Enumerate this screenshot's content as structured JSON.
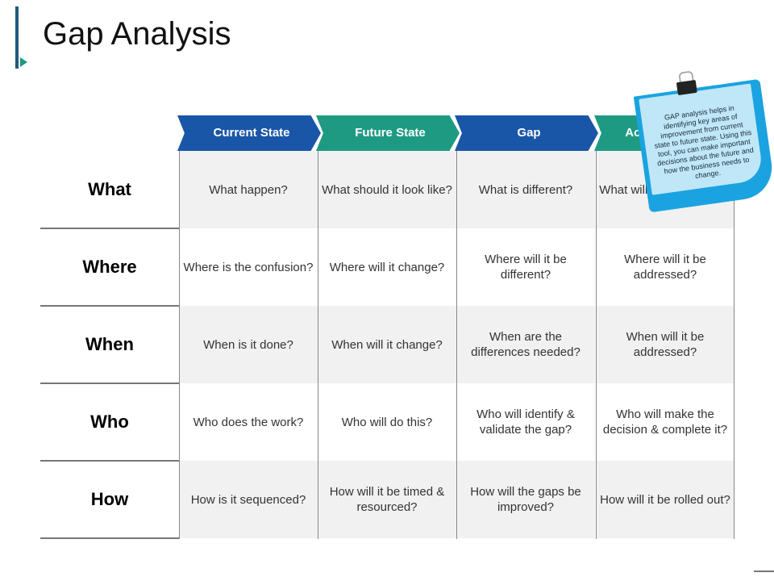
{
  "title": "Gap Analysis",
  "columns": [
    {
      "label": "Current State",
      "color": "#1a56a8"
    },
    {
      "label": "Future State",
      "color": "#1f9a82"
    },
    {
      "label": "Gap",
      "color": "#1a56a8"
    },
    {
      "label": "Action to close",
      "color": "#1f9a82"
    }
  ],
  "rows": [
    {
      "label": "What",
      "cells": [
        "What happen?",
        "What should it look like?",
        "What is different?",
        "What will be addressed?"
      ]
    },
    {
      "label": "Where",
      "cells": [
        "Where is the confusion?",
        "Where will it change?",
        "Where will it be different?",
        "Where will it be addressed?"
      ]
    },
    {
      "label": "When",
      "cells": [
        "When is it done?",
        "When will it change?",
        "When are the differences needed?",
        "When will it be addressed?"
      ]
    },
    {
      "label": "Who",
      "cells": [
        "Who does the work?",
        "Who will do this?",
        "Who will identify & validate the gap?",
        "Who will make the decision & complete it?"
      ]
    },
    {
      "label": "How",
      "cells": [
        "How is it sequenced?",
        "How will it be timed & resourced?",
        "How will the gaps be improved?",
        "How will it be rolled out?"
      ]
    }
  ],
  "note": {
    "text": "GAP analysis helps in identifying key areas of improvement from current state to future state. Using this tool, you can make important decisions about the future and how the business needs to change."
  }
}
